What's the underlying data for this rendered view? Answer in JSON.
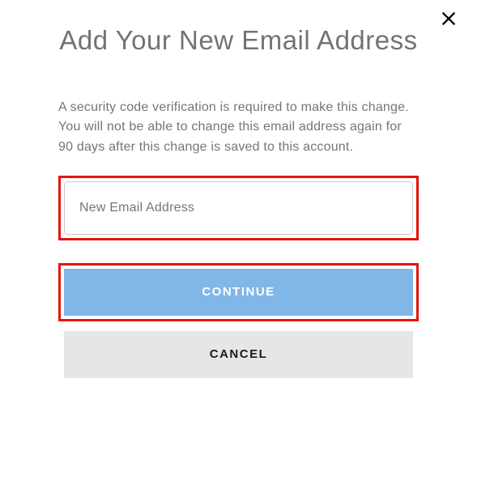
{
  "dialog": {
    "title": "Add Your New Email Address",
    "description": "A security code verification is required to make this change. You will not be able to change this email address again for 90 days after this change is saved to this account.",
    "email_placeholder": "New Email Address",
    "continue_label": "CONTINUE",
    "cancel_label": "CANCEL"
  }
}
